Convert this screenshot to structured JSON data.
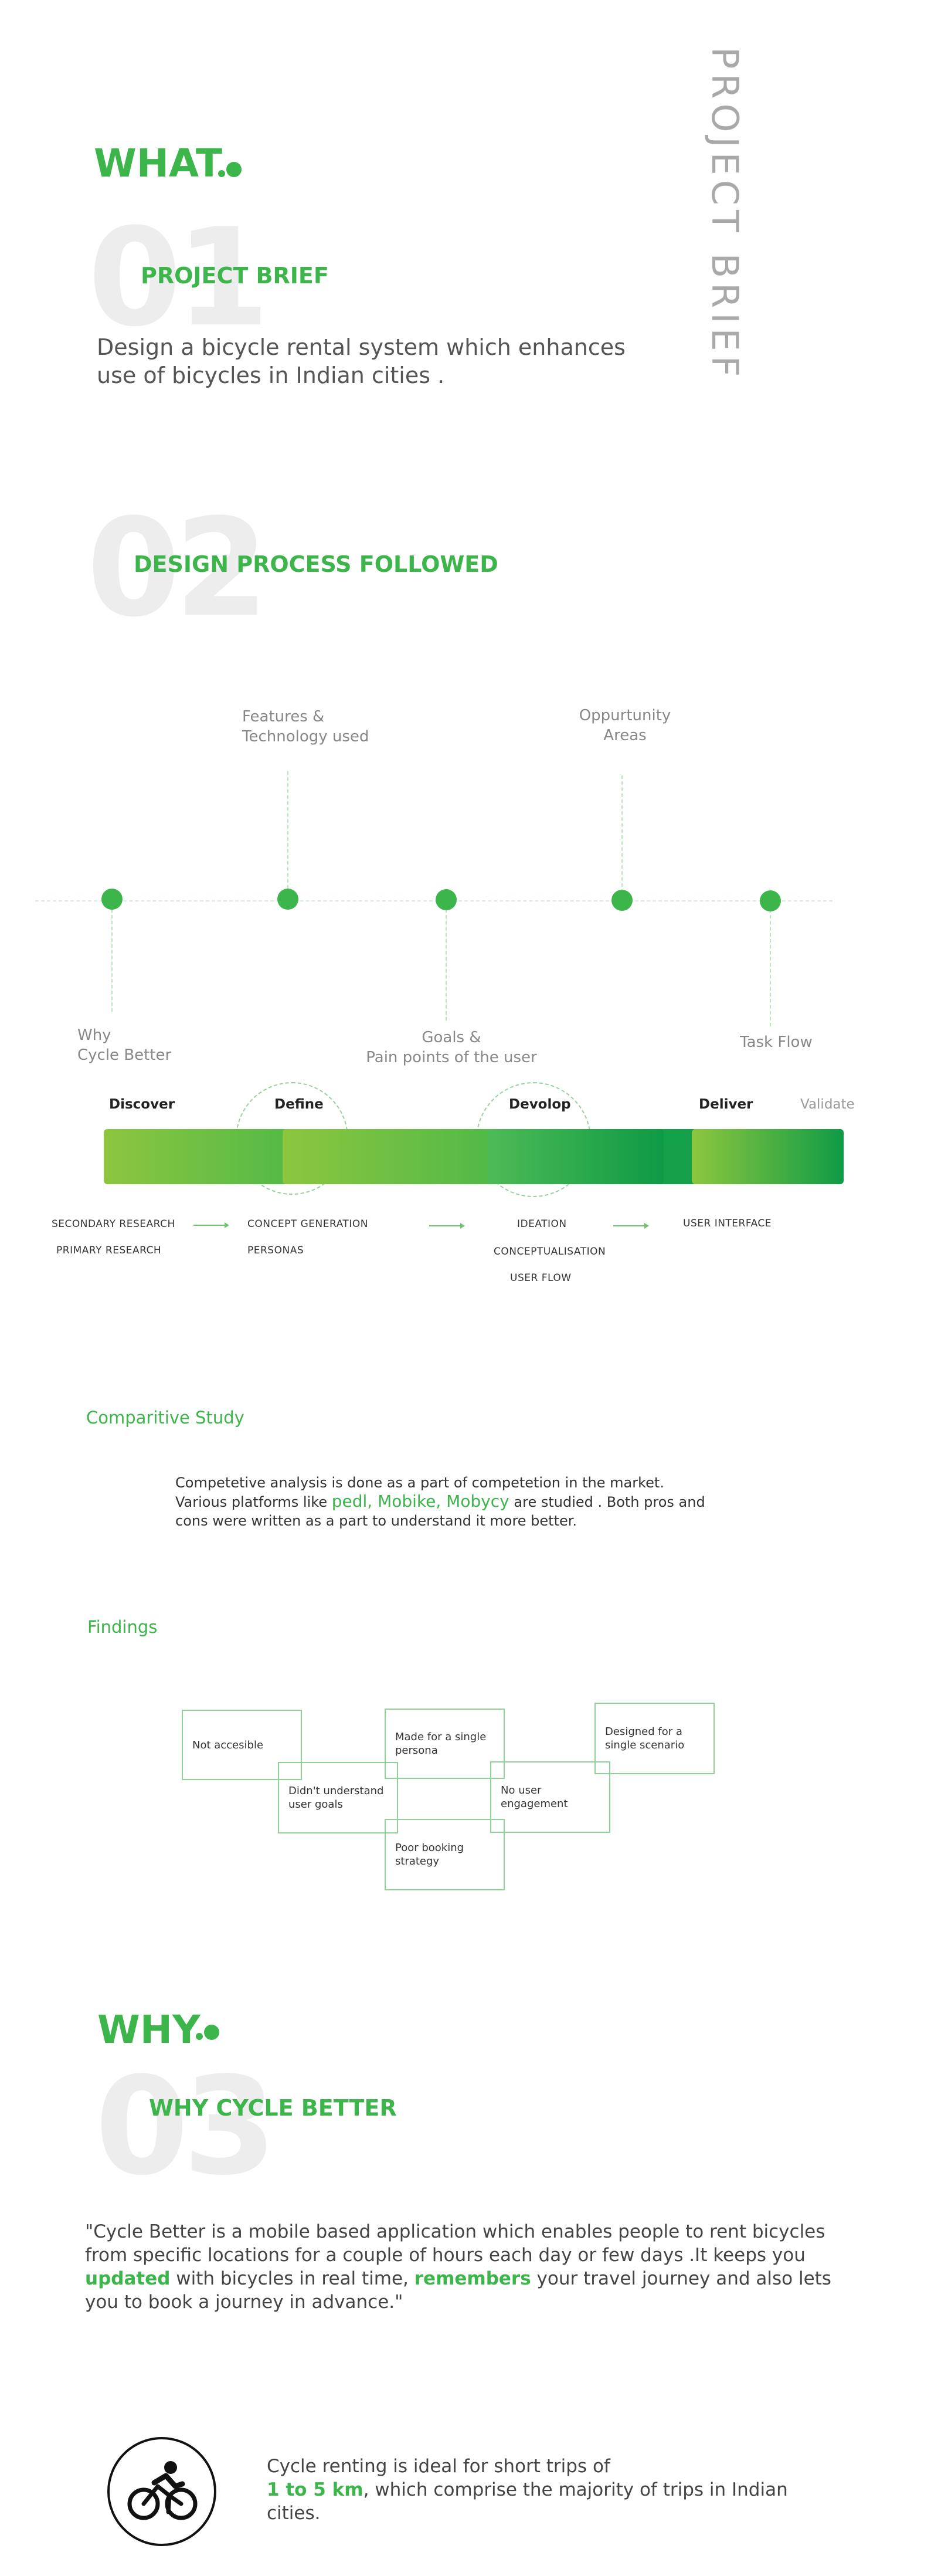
{
  "side_title": "PROJECT BRIEF",
  "what": {
    "heading": "WHAT",
    "number": "01",
    "title": "PROJECT BRIEF",
    "text_line1": "Design a bicycle rental system which enhances",
    "text_line2": "use of bicycles in Indian cities ."
  },
  "process": {
    "number": "02",
    "title": "DESIGN PROCESS FOLLOWED",
    "top_labels": [
      {
        "line1": "Features &",
        "line2": "Technology used"
      },
      {
        "line1": "Oppurtunity",
        "line2": "Areas"
      }
    ],
    "bottom_labels": [
      {
        "line1": "Why",
        "line2": "Cycle Better"
      },
      {
        "line1": "Goals &",
        "line2": "Pain points of the user"
      },
      {
        "line1": "Task Flow",
        "line2": ""
      }
    ],
    "phases": [
      "Discover",
      "Define",
      "Devolop",
      "Deliver",
      "Validate"
    ],
    "steps": {
      "discover": [
        "SECONDARY RESEARCH",
        "PRIMARY RESEARCH"
      ],
      "define": [
        "CONCEPT GENERATION",
        "PERSONAS"
      ],
      "develop": [
        "IDEATION",
        "CONCEPTUALISATION",
        "USER FLOW"
      ],
      "deliver": [
        "USER INTERFACE"
      ]
    }
  },
  "comparative": {
    "title": "Comparitive Study",
    "line1": "Competetive analysis is done as a part of competetion in the market.",
    "line2_pre": "Various platforms like ",
    "line2_brands": "pedl, Mobike, Mobycy",
    "line2_post": "  are studied . Both pros and",
    "line3": "cons were written as a part to understand it more better."
  },
  "findings": {
    "title": "Findings",
    "boxes": [
      "Not accesible",
      "Made for a single persona",
      "Designed for a single scenario",
      "Didn't understand user goals",
      "No user engagement",
      "Poor booking strategy"
    ]
  },
  "why": {
    "heading": "WHY",
    "number": "03",
    "title": "WHY CYCLE BETTER",
    "quote_part1": "\"Cycle Better is a mobile based application which enables people to rent bicycles from specific locations for a couple of hours each day or few days .It keeps you ",
    "quote_hl1": "updated",
    "quote_part2": " with bicycles in real time, ",
    "quote_hl2": "remembers",
    "quote_part3": " your travel journey and also lets you to book a journey in advance.\""
  },
  "bottom": {
    "icon": "cyclist-icon",
    "text_pre": "Cycle renting is ideal for short trips of",
    "text_hl": "1 to 5 km",
    "text_post": ", which comprise the majority of trips in Indian cities."
  },
  "colors": {
    "accent": "#3cb54a",
    "muted": "#ededed"
  }
}
